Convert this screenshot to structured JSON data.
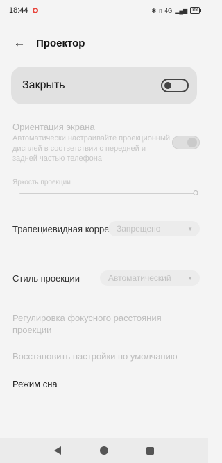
{
  "status": {
    "time": "18:44",
    "network": "4G",
    "battery": "88"
  },
  "header": {
    "title": "Проектор"
  },
  "main_toggle": {
    "label": "Закрыть",
    "on": false
  },
  "orientation": {
    "title": "Ориентация экрана",
    "subtitle": "Автоматически настраивайте проекционный дисплей в соответствии с передней и задней частью телефона",
    "on": true
  },
  "brightness": {
    "label": "Яркость проекции",
    "level_percent": 100
  },
  "keystone": {
    "label": "Трапециевидная коррекция",
    "value": "Запрещено"
  },
  "projection_style": {
    "label": "Стиль проекции",
    "value": "Автоматический"
  },
  "focus": {
    "label": "Регулировка фокусного расстояния проекции"
  },
  "reset": {
    "label": "Восстановить настройки по умолчанию"
  },
  "sleep": {
    "label": "Режим сна"
  },
  "colors": {
    "background": "#f4f4f4",
    "card": "#e1e1e1",
    "disabled_text": "#bdbdbd",
    "status_accent": "#e8453c"
  }
}
